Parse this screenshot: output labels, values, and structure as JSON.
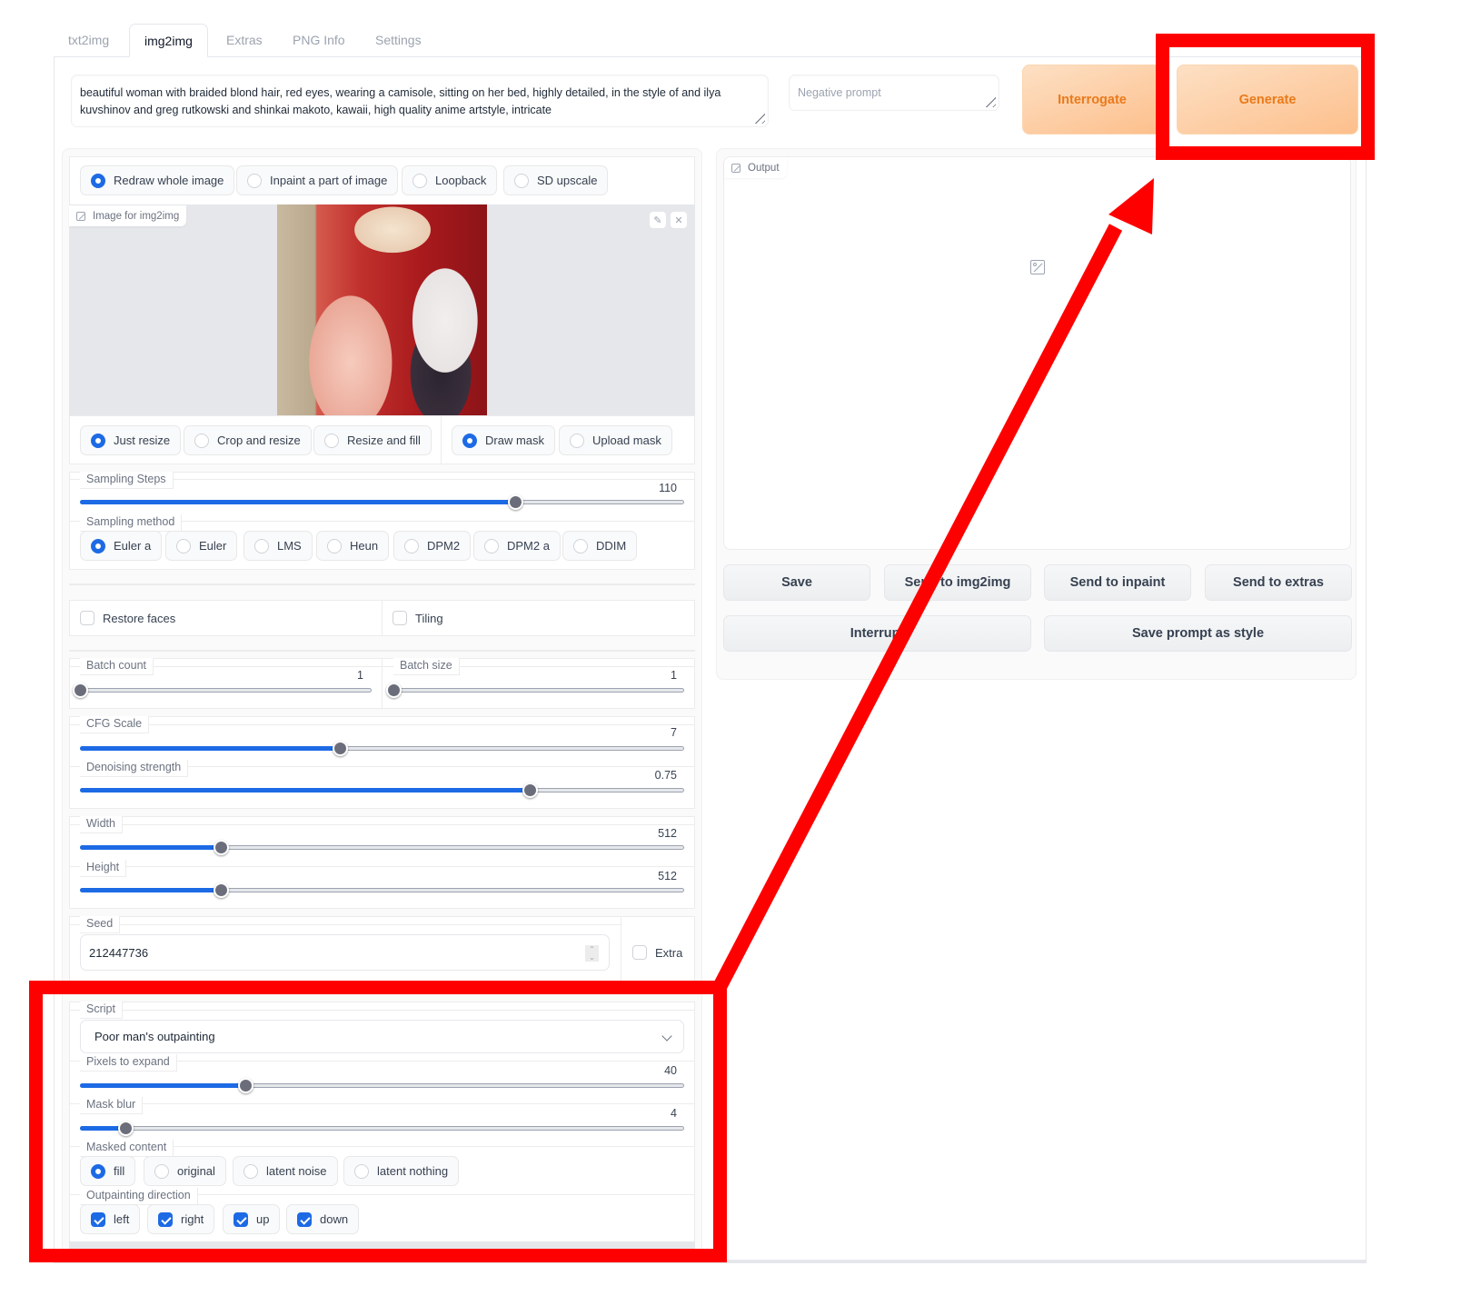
{
  "tabs": [
    {
      "label": "txt2img",
      "active": false
    },
    {
      "label": "img2img",
      "active": true
    },
    {
      "label": "Extras",
      "active": false
    },
    {
      "label": "PNG Info",
      "active": false
    },
    {
      "label": "Settings",
      "active": false
    }
  ],
  "prompt": {
    "value": "beautiful woman with braided blond hair, red eyes, wearing a camisole, sitting on her bed, highly detailed, in the style of and ilya kuvshinov and greg rutkowski and shinkai makoto, kawaii, high quality anime artstyle, intricate"
  },
  "negative_prompt": {
    "placeholder": "Negative prompt",
    "value": ""
  },
  "buttons": {
    "interrogate": "Interrogate",
    "generate": "Generate"
  },
  "mode": {
    "options": [
      "Redraw whole image",
      "Inpaint a part of image",
      "Loopback",
      "SD upscale"
    ],
    "selected": "Redraw whole image"
  },
  "image_input": {
    "label": "Image for img2img",
    "edit_icon": "pencil-icon",
    "clear_icon": "close-icon"
  },
  "resize_mode": {
    "options": [
      "Just resize",
      "Crop and resize",
      "Resize and fill"
    ],
    "selected": "Just resize"
  },
  "mask_mode": {
    "options": [
      "Draw mask",
      "Upload mask"
    ],
    "selected": "Draw mask"
  },
  "sampling_steps": {
    "label": "Sampling Steps",
    "value": "110",
    "fraction": 0.72
  },
  "sampling_method": {
    "label": "Sampling method",
    "options": [
      "Euler a",
      "Euler",
      "LMS",
      "Heun",
      "DPM2",
      "DPM2 a",
      "DDIM"
    ],
    "selected": "Euler a"
  },
  "restore_faces": {
    "label": "Restore faces",
    "checked": false
  },
  "tiling": {
    "label": "Tiling",
    "checked": false
  },
  "batch_count": {
    "label": "Batch count",
    "value": "1",
    "fraction": 0.0
  },
  "batch_size": {
    "label": "Batch size",
    "value": "1",
    "fraction": 0.0
  },
  "cfg_scale": {
    "label": "CFG Scale",
    "value": "7",
    "fraction": 0.43
  },
  "denoising_strength": {
    "label": "Denoising strength",
    "value": "0.75",
    "fraction": 0.745
  },
  "width": {
    "label": "Width",
    "value": "512",
    "fraction": 0.233
  },
  "height": {
    "label": "Height",
    "value": "512",
    "fraction": 0.233
  },
  "seed": {
    "label": "Seed",
    "value": "212447736"
  },
  "extra": {
    "label": "Extra",
    "checked": false
  },
  "script": {
    "label": "Script",
    "selected": "Poor man's outpainting"
  },
  "pixels_to_expand": {
    "label": "Pixels to expand",
    "value": "40",
    "fraction": 0.273
  },
  "mask_blur": {
    "label": "Mask blur",
    "value": "4",
    "fraction": 0.075
  },
  "masked_content": {
    "label": "Masked content",
    "options": [
      "fill",
      "original",
      "latent noise",
      "latent nothing"
    ],
    "selected": "fill"
  },
  "outpainting_direction": {
    "label": "Outpainting direction",
    "options": [
      {
        "label": "left",
        "checked": true
      },
      {
        "label": "right",
        "checked": true
      },
      {
        "label": "up",
        "checked": true
      },
      {
        "label": "down",
        "checked": true
      }
    ]
  },
  "output": {
    "label": "Output",
    "placeholder_icon": "image-icon",
    "buttons": [
      "Save",
      "Send to img2img",
      "Send to inpaint",
      "Send to extras"
    ],
    "buttons_row2": [
      "Interrupt",
      "Save prompt as style"
    ]
  },
  "annotations": {
    "color": "#ff0000",
    "highlight_targets": [
      "generate-button",
      "script-section"
    ],
    "arrow": "from script section to Generate button"
  }
}
